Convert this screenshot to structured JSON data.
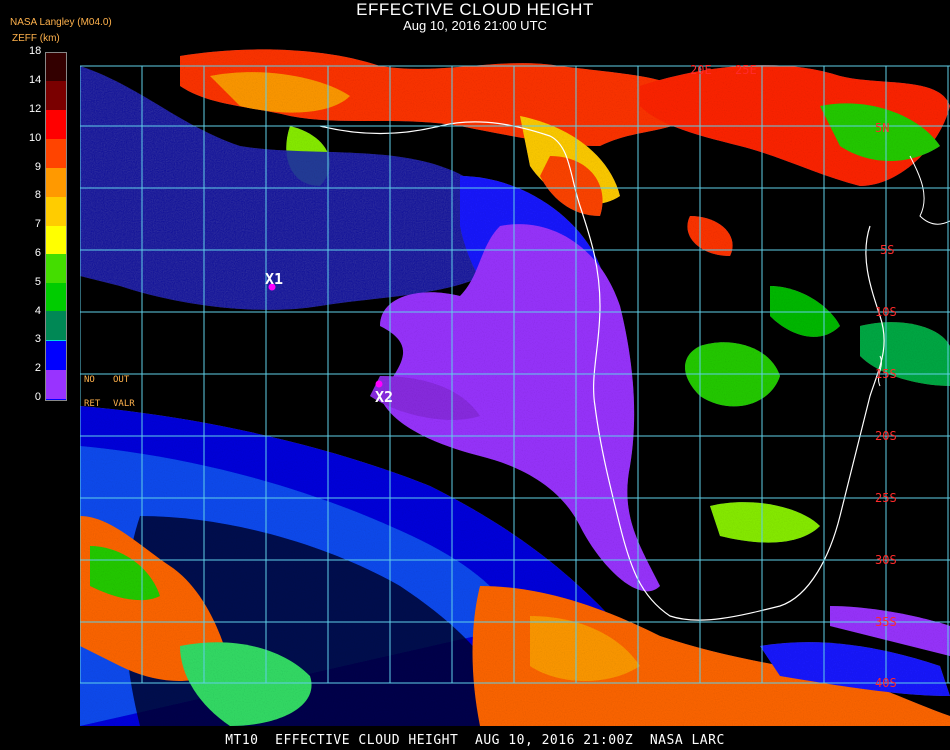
{
  "header": {
    "title": "EFFECTIVE CLOUD HEIGHT",
    "subtitle": "Aug 10, 2016 21:00 UTC",
    "source": "NASA Langley (M04.0)",
    "unit": "ZEFF (km)"
  },
  "legend": {
    "ticks": [
      "18",
      "14",
      "12",
      "10",
      "9",
      "8",
      "7",
      "6",
      "5",
      "4",
      "3",
      "2",
      "1",
      "0"
    ],
    "colors": [
      "#330000",
      "#7a0000",
      "#ff0000",
      "#ff4400",
      "#ff9900",
      "#ffcc00",
      "#ffff00",
      "#99ee00",
      "#00cc00",
      "#008844",
      "#00dddd",
      "#2299ff",
      "#0000ff",
      "#9933ff"
    ],
    "notes": {
      "no": "NO",
      "out": "OUT",
      "ret": "RET",
      "valr": "VALR"
    }
  },
  "map": {
    "lat_labels": [
      "25E",
      "20E",
      "5N",
      "5S",
      "10S",
      "15S",
      "20S",
      "25S",
      "30S",
      "35S",
      "40S"
    ],
    "markers": [
      "X1",
      "X2"
    ],
    "grid_color": "#5fd0e8",
    "coast_color": "#ffffff"
  },
  "footer": "MT10  EFFECTIVE CLOUD HEIGHT  AUG 10, 2016 21:00Z  NASA LARC"
}
